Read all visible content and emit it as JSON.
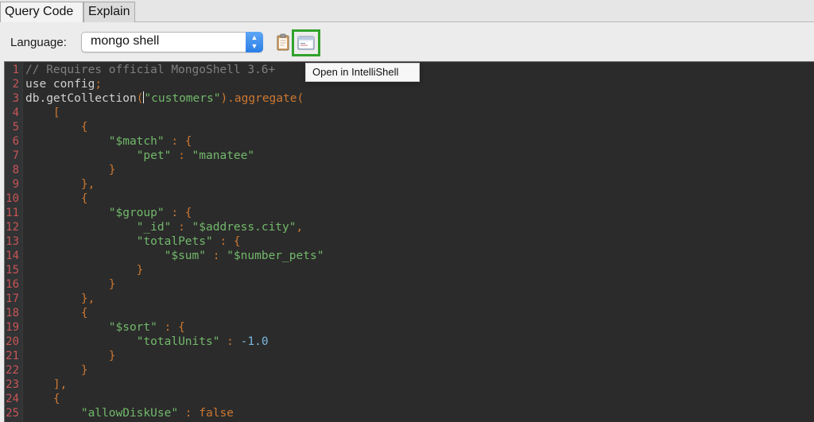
{
  "tabs": [
    {
      "label": "Query Code",
      "active": true
    },
    {
      "label": "Explain",
      "active": false
    }
  ],
  "toolbar": {
    "language_label": "Language:",
    "language_value": "mongo shell",
    "copy_icon": "clipboard-icon",
    "open_icon": "intellishell-icon",
    "tooltip": "Open in IntelliShell",
    "highlight_color": "#30a22c"
  },
  "editor": {
    "colors": {
      "background": "#2b2b2b",
      "keyword": "#cc7832",
      "string": "#72b86b",
      "number": "#79b8dd",
      "comment": "#7f7f7f",
      "line_number": "#c85656"
    },
    "lines": [
      {
        "n": "1",
        "tokens": [
          {
            "t": "// Requires official MongoShell 3.6+",
            "c": "comment"
          }
        ]
      },
      {
        "n": "2",
        "tokens": [
          {
            "t": "use config",
            "c": "plain"
          },
          {
            "t": ";",
            "c": "kw"
          }
        ]
      },
      {
        "n": "3",
        "tokens": [
          {
            "t": "db.getCollection",
            "c": "plain"
          },
          {
            "t": "(",
            "c": "kw"
          },
          {
            "t": "",
            "c": "caret"
          },
          {
            "t": "\"customers\"",
            "c": "str"
          },
          {
            "t": ").aggregate(",
            "c": "kw"
          }
        ]
      },
      {
        "n": "4",
        "tokens": [
          {
            "t": "    [",
            "c": "kw"
          }
        ]
      },
      {
        "n": "5",
        "tokens": [
          {
            "t": "        {",
            "c": "kw"
          }
        ]
      },
      {
        "n": "6",
        "tokens": [
          {
            "t": "            ",
            "c": "plain"
          },
          {
            "t": "\"$match\"",
            "c": "str"
          },
          {
            "t": " : {",
            "c": "kw"
          }
        ]
      },
      {
        "n": "7",
        "tokens": [
          {
            "t": "                ",
            "c": "plain"
          },
          {
            "t": "\"pet\"",
            "c": "str"
          },
          {
            "t": " : ",
            "c": "kw"
          },
          {
            "t": "\"manatee\"",
            "c": "str"
          }
        ]
      },
      {
        "n": "8",
        "tokens": [
          {
            "t": "            }",
            "c": "kw"
          }
        ]
      },
      {
        "n": "9",
        "tokens": [
          {
            "t": "        },",
            "c": "kw"
          }
        ]
      },
      {
        "n": "10",
        "tokens": [
          {
            "t": "        {",
            "c": "kw"
          }
        ]
      },
      {
        "n": "11",
        "tokens": [
          {
            "t": "            ",
            "c": "plain"
          },
          {
            "t": "\"$group\"",
            "c": "str"
          },
          {
            "t": " : {",
            "c": "kw"
          }
        ]
      },
      {
        "n": "12",
        "tokens": [
          {
            "t": "                ",
            "c": "plain"
          },
          {
            "t": "\"_id\"",
            "c": "str"
          },
          {
            "t": " : ",
            "c": "kw"
          },
          {
            "t": "\"$address.city\"",
            "c": "str"
          },
          {
            "t": ",",
            "c": "kw"
          }
        ]
      },
      {
        "n": "13",
        "tokens": [
          {
            "t": "                ",
            "c": "plain"
          },
          {
            "t": "\"totalPets\"",
            "c": "str"
          },
          {
            "t": " : {",
            "c": "kw"
          }
        ]
      },
      {
        "n": "14",
        "tokens": [
          {
            "t": "                    ",
            "c": "plain"
          },
          {
            "t": "\"$sum\"",
            "c": "str"
          },
          {
            "t": " : ",
            "c": "kw"
          },
          {
            "t": "\"$number_pets\"",
            "c": "str"
          }
        ]
      },
      {
        "n": "15",
        "tokens": [
          {
            "t": "                }",
            "c": "kw"
          }
        ]
      },
      {
        "n": "16",
        "tokens": [
          {
            "t": "            }",
            "c": "kw"
          }
        ]
      },
      {
        "n": "17",
        "tokens": [
          {
            "t": "        },",
            "c": "kw"
          }
        ]
      },
      {
        "n": "18",
        "tokens": [
          {
            "t": "        {",
            "c": "kw"
          }
        ]
      },
      {
        "n": "19",
        "tokens": [
          {
            "t": "            ",
            "c": "plain"
          },
          {
            "t": "\"$sort\"",
            "c": "str"
          },
          {
            "t": " : {",
            "c": "kw"
          }
        ]
      },
      {
        "n": "20",
        "tokens": [
          {
            "t": "                ",
            "c": "plain"
          },
          {
            "t": "\"totalUnits\"",
            "c": "str"
          },
          {
            "t": " : ",
            "c": "kw"
          },
          {
            "t": "-1.0",
            "c": "num"
          }
        ]
      },
      {
        "n": "21",
        "tokens": [
          {
            "t": "            }",
            "c": "kw"
          }
        ]
      },
      {
        "n": "22",
        "tokens": [
          {
            "t": "        }",
            "c": "kw"
          }
        ]
      },
      {
        "n": "23",
        "tokens": [
          {
            "t": "    ],",
            "c": "kw"
          }
        ]
      },
      {
        "n": "24",
        "tokens": [
          {
            "t": "    {",
            "c": "kw"
          }
        ]
      },
      {
        "n": "25",
        "tokens": [
          {
            "t": "        ",
            "c": "plain"
          },
          {
            "t": "\"allowDiskUse\"",
            "c": "str"
          },
          {
            "t": " : ",
            "c": "kw"
          },
          {
            "t": "false",
            "c": "kw"
          }
        ]
      }
    ]
  }
}
